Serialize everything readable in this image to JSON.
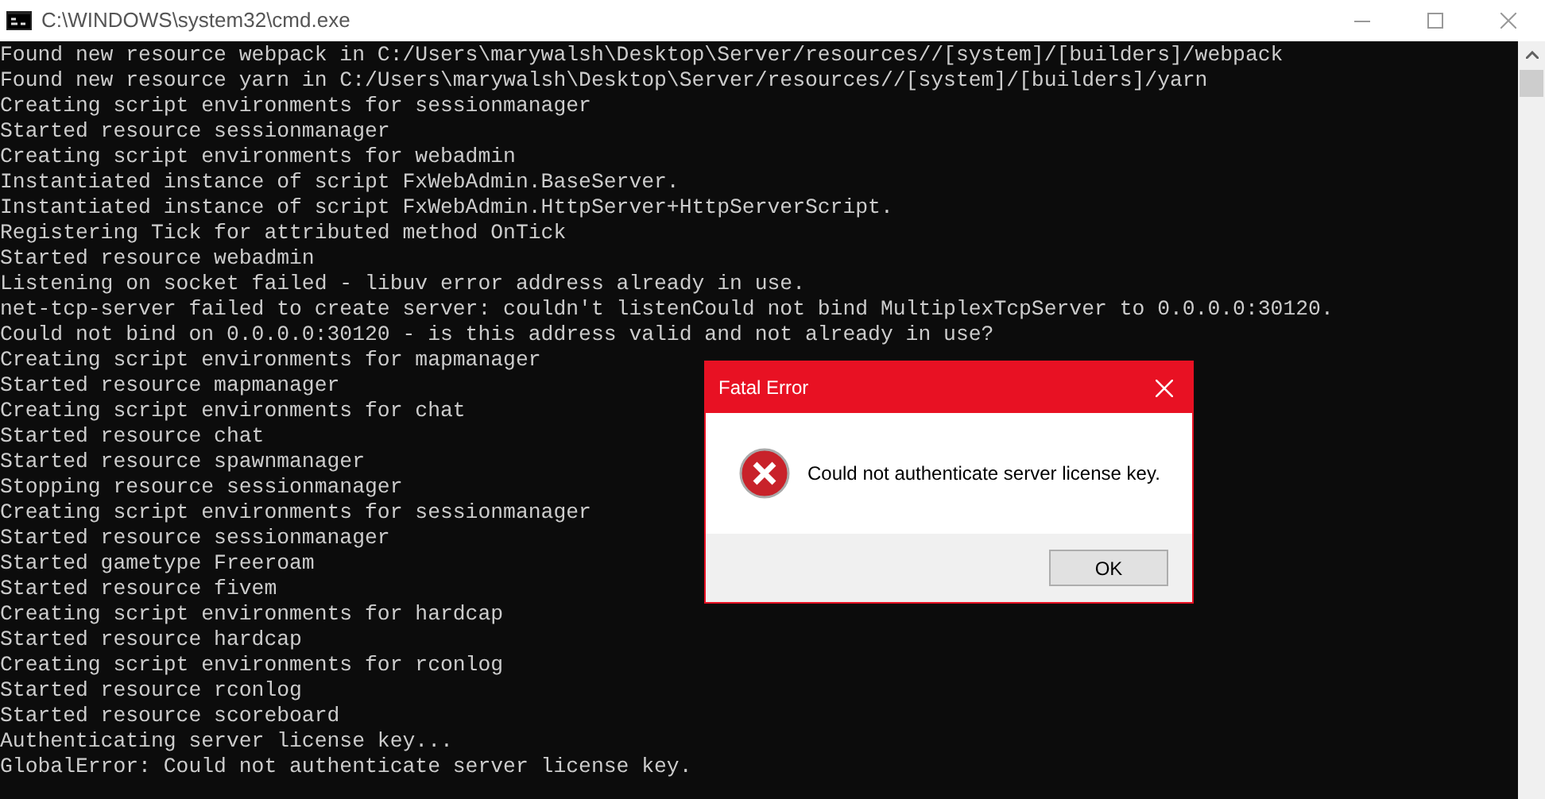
{
  "window": {
    "title": "C:\\WINDOWS\\system32\\cmd.exe"
  },
  "console_lines": [
    "Found new resource webpack in C:/Users\\marywalsh\\Desktop\\Server/resources//[system]/[builders]/webpack",
    "Found new resource yarn in C:/Users\\marywalsh\\Desktop\\Server/resources//[system]/[builders]/yarn",
    "Creating script environments for sessionmanager",
    "Started resource sessionmanager",
    "Creating script environments for webadmin",
    "Instantiated instance of script FxWebAdmin.BaseServer.",
    "Instantiated instance of script FxWebAdmin.HttpServer+HttpServerScript.",
    "Registering Tick for attributed method OnTick",
    "Started resource webadmin",
    "Listening on socket failed - libuv error address already in use.",
    "net-tcp-server failed to create server: couldn't listenCould not bind MultiplexTcpServer to 0.0.0.0:30120.",
    "Could not bind on 0.0.0.0:30120 - is this address valid and not already in use?",
    "Creating script environments for mapmanager",
    "Started resource mapmanager",
    "Creating script environments for chat",
    "Started resource chat",
    "Started resource spawnmanager",
    "Stopping resource sessionmanager",
    "Creating script environments for sessionmanager",
    "Started resource sessionmanager",
    "Started gametype Freeroam",
    "Started resource fivem",
    "Creating script environments for hardcap",
    "Started resource hardcap",
    "Creating script environments for rconlog",
    "Started resource rconlog",
    "Started resource scoreboard",
    "Authenticating server license key...",
    "GlobalError: Could not authenticate server license key."
  ],
  "dialog": {
    "title": "Fatal Error",
    "message": "Could not authenticate server license key.",
    "buttons": [
      "OK"
    ]
  }
}
